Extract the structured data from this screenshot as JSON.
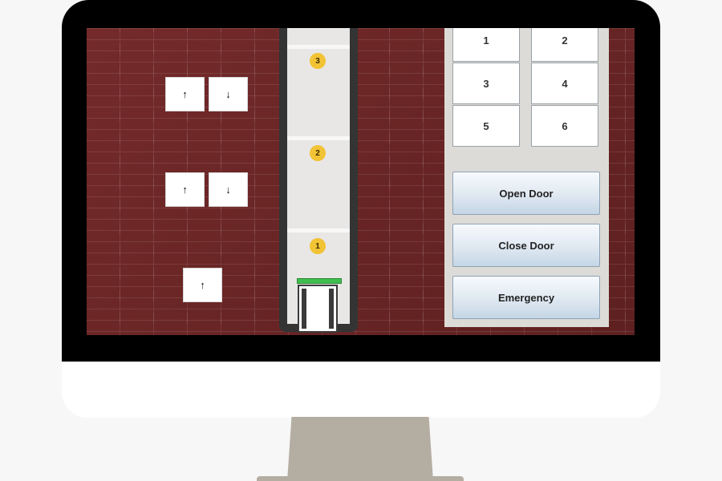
{
  "hall_calls": {
    "floor3": {
      "up": "↑",
      "down": "↓"
    },
    "floor2": {
      "up": "↑",
      "down": "↓"
    },
    "floor1": {
      "up": "↑"
    }
  },
  "shaft": {
    "floors": [
      {
        "number": "3"
      },
      {
        "number": "2"
      },
      {
        "number": "1"
      }
    ],
    "current_floor": 1,
    "indicator_color": "#3fbf4f"
  },
  "panel": {
    "floor_buttons": [
      "1",
      "2",
      "3",
      "4",
      "5",
      "6"
    ],
    "open_door": "Open Door",
    "close_door": "Close Door",
    "emergency": "Emergency"
  },
  "colors": {
    "brick": "#6e2626",
    "badge": "#f2c334",
    "button_gradient_top": "#f7fafd",
    "button_gradient_bottom": "#c5d6e6"
  }
}
